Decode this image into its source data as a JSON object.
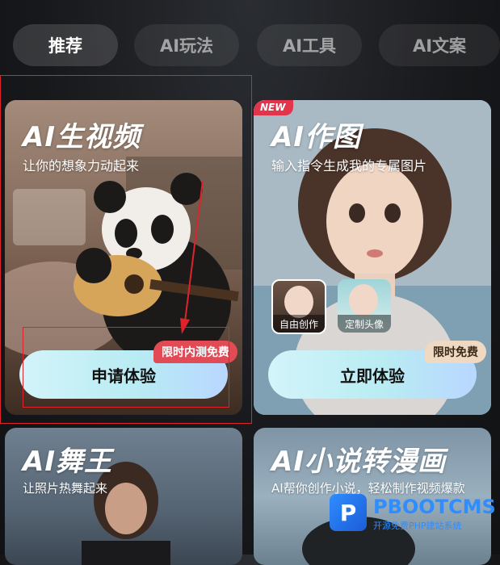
{
  "tabs": [
    {
      "label": "推荐",
      "active": true
    },
    {
      "label": "AI玩法",
      "active": false
    },
    {
      "label": "AI工具",
      "active": false
    },
    {
      "label": "AI文案",
      "active": false
    }
  ],
  "cards": {
    "video": {
      "title": "AI生视频",
      "subtitle": "让你的想象力动起来",
      "badge": "限时内测免费",
      "cta": "申请体验"
    },
    "image": {
      "new_badge": "NEW",
      "title": "AI作图",
      "subtitle": "输入指令生成我的专属图片",
      "thumbs": [
        "自由创作",
        "定制头像"
      ],
      "badge": "限时免费",
      "cta": "立即体验"
    },
    "dance": {
      "title": "AI舞王",
      "subtitle": "让照片热舞起来"
    },
    "novel": {
      "title": "AI小说转漫画",
      "subtitle": "AI帮你创作小说，轻松制作视频爆款"
    }
  },
  "watermark": {
    "name": "PBOOTCMS",
    "tagline": "开源免费PHP建站系统",
    "logo_letter": "P"
  },
  "colors": {
    "highlight": "#e0222a",
    "badge_red": "#e14b55",
    "badge_tan": "#efd9c2",
    "cta_gradient_start": "#d3f4fa",
    "cta_gradient_end": "#b9d7ff"
  }
}
